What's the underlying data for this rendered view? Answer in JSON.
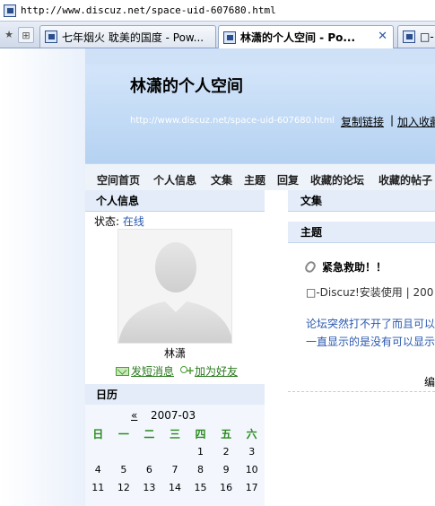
{
  "browser": {
    "address_url": "http://www.discuz.net/space-uid-607680.html",
    "tabs": [
      {
        "label": "七年烟火  耽美的国度 - Pow..."
      },
      {
        "label": "林潇的个人空间 - Po..."
      },
      {
        "label": "□-"
      }
    ]
  },
  "header": {
    "title": "林潇的个人空间",
    "url": "http://www.discuz.net/space-uid-607680.html",
    "copy_link": "复制链接",
    "separator": "|",
    "add_favorite": "加入收藏"
  },
  "nav": {
    "items": [
      "空间首页",
      "个人信息",
      "文集",
      "主题",
      "回复",
      "收藏的论坛",
      "收藏的帖子"
    ]
  },
  "profile": {
    "heading": "个人信息",
    "status_label": "状态:",
    "status_value": "在线",
    "username": "林潇",
    "send_message": "发短消息",
    "add_friend": "加为好友"
  },
  "calendar": {
    "heading": "日历",
    "prev": "«",
    "year_month": "2007-03",
    "weekdays": [
      "日",
      "一",
      "二",
      "三",
      "四",
      "五",
      "六"
    ],
    "rows": [
      [
        "",
        "",
        "",
        "",
        "1",
        "2",
        "3"
      ],
      [
        "4",
        "5",
        "6",
        "7",
        "8",
        "9",
        "10"
      ],
      [
        "11",
        "12",
        "13",
        "14",
        "15",
        "16",
        "17"
      ]
    ]
  },
  "main": {
    "articles_heading": "文集",
    "topics_heading": "主题",
    "post": {
      "title": "紧急救助！！",
      "meta": "□-Discuz!安装使用  |  200",
      "line1": "论坛突然打不开了而且可以",
      "line2": "一直显示的是没有可以显示",
      "edit": "编"
    }
  }
}
